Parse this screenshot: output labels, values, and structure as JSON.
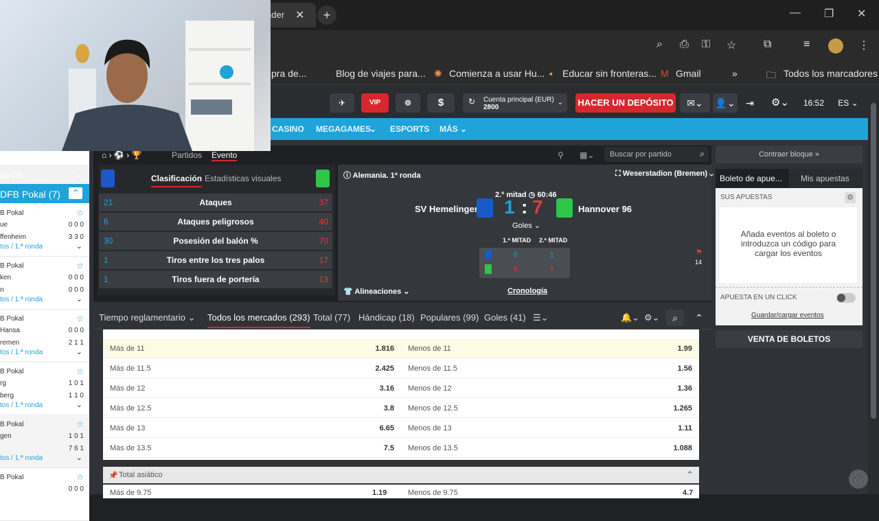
{
  "browser": {
    "tab_title_fragment": "nder",
    "bookmarks": [
      "pra de...",
      "Blog de viajes para...",
      "Comienza a usar Hu...",
      "Educar sin fronteras...",
      "Gmail",
      "Todos los marcadores"
    ],
    "overflow": "»"
  },
  "header": {
    "vip_label": "VIP",
    "account_label": "Cuenta principal  (EUR)",
    "account_balance": "2800",
    "deposit_label": "HACER UN DEPÓSITO",
    "time": "16:52",
    "lang": "ES"
  },
  "nav": [
    "CASINO",
    "MEGAGAMES",
    "ESPORTS",
    "MÁS"
  ],
  "left_sidebar": {
    "category_1": "os (9)",
    "category_2": "DFB Pokal (7)",
    "matches": [
      {
        "league": "B Pokal",
        "team1": "ue",
        "score1": "0 0 0",
        "team2": "ffenheim",
        "score2": "3 3 0",
        "round": "tos / 1.ª ronda"
      },
      {
        "league": "B Pokal",
        "team1": "ken",
        "score1": "0 0 0",
        "team2": "n",
        "score2": "0 0 0",
        "round": "tos / 1.ª ronda"
      },
      {
        "league": "B Pokal",
        "team1": "Hansa",
        "score1": "0 0 0",
        "team2": "remen",
        "score2": "2 1 1",
        "round": "tos / 1.ª ronda"
      },
      {
        "league": "B Pokal",
        "team1": "rg",
        "score1": "1 0 1",
        "team2": "berg",
        "score2": "1 1 0",
        "round": "tos / 1.ª ronda"
      },
      {
        "league": "B Pokal",
        "team1": "gen",
        "score1": "1 0 1",
        "team2": "",
        "score2": "7 6 1",
        "round": "tos / 1.ª ronda"
      },
      {
        "league": "B Pokal",
        "team1": "",
        "score1": "0 0 0",
        "team2": "",
        "score2": "",
        "round": ""
      }
    ]
  },
  "event": {
    "breadcrumb_tabs": [
      "Partidos",
      "Evento"
    ],
    "search_placeholder": "Buscar por partido",
    "stats_tabs": [
      "Clasificación",
      "Estadísticas visuales"
    ],
    "stats": [
      {
        "left": "21",
        "name": "Ataques",
        "right": "37"
      },
      {
        "left": "6",
        "name": "Ataques peligrosos",
        "right": "40"
      },
      {
        "left": "30",
        "name": "Posesión del balón %",
        "right": "70"
      },
      {
        "left": "1",
        "name": "Tiros entre los tres palos",
        "right": "17"
      },
      {
        "left": "1",
        "name": "Tiros fuera de portería",
        "right": "13"
      }
    ],
    "competition": "Alemania. 1ª ronda",
    "stadium": "Weserstadion (Bremen)",
    "period": "2.º mitad",
    "clock": "60:46",
    "home_team": "SV Hemelingen",
    "away_team": "Hannover 96",
    "home_score": "1",
    "away_score": "7",
    "separator": ":",
    "goals_label": "Goles",
    "half_labels": [
      "1.ª MITAD",
      "2.ª MITAD"
    ],
    "home_halves": [
      "0",
      "1"
    ],
    "away_halves": [
      "6",
      "1"
    ],
    "corners": "14",
    "lineups_label": "Alineaciones",
    "timeline_label": "Cronología"
  },
  "market_bar": {
    "period_select": "Tiempo reglamentario",
    "tabs": [
      "Todos los mercados (293)",
      "Total (77)",
      "Hándicap (18)",
      "Populares (99)",
      "Goles (41)"
    ]
  },
  "odds": [
    {
      "over": "Más de 11",
      "over_odd": "1.816",
      "under": "Menos de 11",
      "under_odd": "1.99"
    },
    {
      "over": "Más de 11.5",
      "over_odd": "2.425",
      "under": "Menos de 11.5",
      "under_odd": "1.56"
    },
    {
      "over": "Más de 12",
      "over_odd": "3.16",
      "under": "Menos de 12",
      "under_odd": "1.36"
    },
    {
      "over": "Más de 12.5",
      "over_odd": "3.8",
      "under": "Menos de 12.5",
      "under_odd": "1.265"
    },
    {
      "over": "Más de 13",
      "over_odd": "6.65",
      "under": "Menos de 13",
      "under_odd": "1.11"
    },
    {
      "over": "Más de 13.5",
      "over_odd": "7.5",
      "under": "Menos de 13.5",
      "under_odd": "1.088"
    }
  ],
  "asian_total": {
    "title": "Total asiático",
    "first_row": {
      "over": "Más de 9.75",
      "over_odd": "1.19",
      "under": "Menos de 9.75",
      "under_odd": "4.7"
    }
  },
  "betslip": {
    "collapse_label": "Contraer bloque",
    "tabs": [
      "Boleto de apue...",
      "Mis apuestas"
    ],
    "your_bets": "SUS APUESTAS",
    "empty_text": "Añada eventos al boleto o introduzca un código para cargar los eventos",
    "one_click": "APUESTA EN UN CLICK",
    "save_load": "Guardar/cargar eventos",
    "sell_label": "VENTA DE BOLETOS"
  }
}
